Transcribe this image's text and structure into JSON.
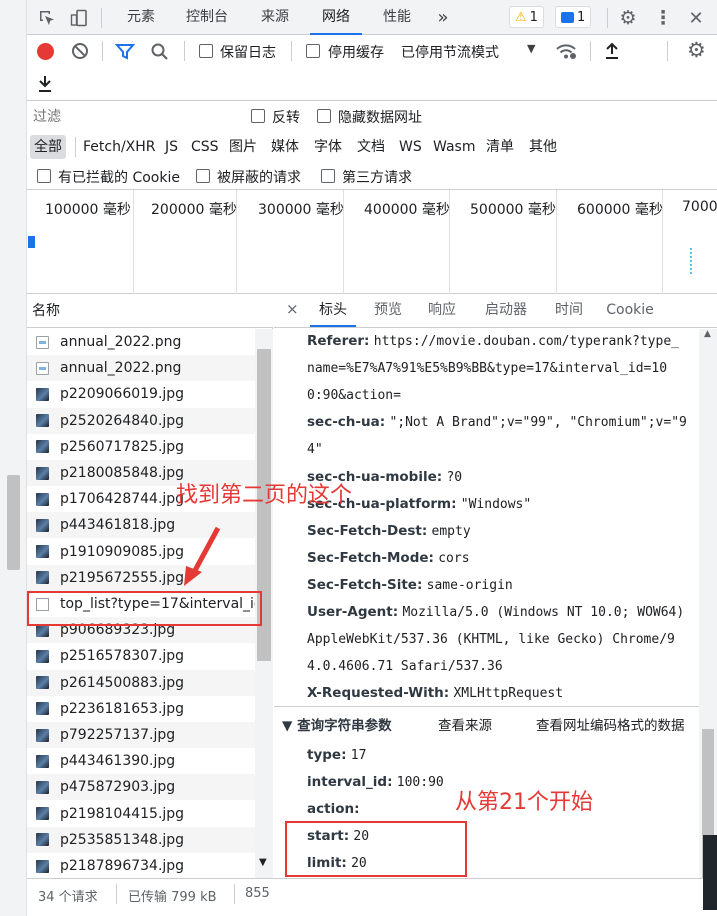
{
  "tabs": [
    "元素",
    "控制台",
    "来源",
    "网络",
    "性能"
  ],
  "more_tabs": "»",
  "warnings": {
    "icon": "warning-icon",
    "count": "1"
  },
  "messages": {
    "icon": "message-icon",
    "count": "1"
  },
  "toolbar": {
    "preserve_log": "保留日志",
    "disable_cache": "停用缓存",
    "throttle": "已停用节流模式"
  },
  "filter": {
    "placeholder": "过滤",
    "invert": "反转",
    "hide_data_urls": "隐藏数据网址"
  },
  "types": [
    "全部",
    "Fetch/XHR",
    "JS",
    "CSS",
    "图片",
    "媒体",
    "字体",
    "文档",
    "WS",
    "Wasm",
    "清单",
    "其他"
  ],
  "cookie_row": {
    "blocked_cookies": "有已拦截的 Cookie",
    "blocked_requests": "被屏蔽的请求",
    "third_party": "第三方请求"
  },
  "overview_ticks": [
    "100000 毫秒",
    "200000 毫秒",
    "300000 毫秒",
    "400000 毫秒",
    "500000 毫秒",
    "600000 毫秒",
    "7000"
  ],
  "list": {
    "header": "名称",
    "rows": [
      {
        "name": "annual_2022.png",
        "type": "png"
      },
      {
        "name": "annual_2022.png",
        "type": "png"
      },
      {
        "name": "p2209066019.jpg",
        "type": "jpg"
      },
      {
        "name": "p2520264840.jpg",
        "type": "jpg"
      },
      {
        "name": "p2560717825.jpg",
        "type": "jpg"
      },
      {
        "name": "p2180085848.jpg",
        "type": "jpg"
      },
      {
        "name": "p1706428744.jpg",
        "type": "jpg"
      },
      {
        "name": "p443461818.jpg",
        "type": "jpg"
      },
      {
        "name": "p1910909085.jpg",
        "type": "jpg"
      },
      {
        "name": "p2195672555.jpg",
        "type": "jpg"
      },
      {
        "name": "top_list?type=17&interval_id...",
        "type": "doc"
      },
      {
        "name": "p906689323.jpg",
        "type": "jpg"
      },
      {
        "name": "p2516578307.jpg",
        "type": "jpg"
      },
      {
        "name": "p2614500883.jpg",
        "type": "jpg"
      },
      {
        "name": "p2236181653.jpg",
        "type": "jpg"
      },
      {
        "name": "p792257137.jpg",
        "type": "jpg"
      },
      {
        "name": "p443461390.jpg",
        "type": "jpg"
      },
      {
        "name": "p475872903.jpg",
        "type": "jpg"
      },
      {
        "name": "p2198104415.jpg",
        "type": "jpg"
      },
      {
        "name": "p2535851348.jpg",
        "type": "jpg"
      },
      {
        "name": "p2187896734.jpg",
        "type": "jpg"
      }
    ]
  },
  "status": {
    "requests": "34 个请求",
    "transferred": "已传输 799 kB",
    "more": "855"
  },
  "details": {
    "close": "×",
    "tabs": [
      "标头",
      "预览",
      "响应",
      "启动器",
      "时间",
      "Cookie"
    ],
    "headers": [
      {
        "key": "Referer:",
        "value": "https://movie.douban.com/typerank?type_"
      },
      {
        "key": "",
        "value": "name=%E7%A7%91%E5%B9%BB&type=17&interval_id=10"
      },
      {
        "key": "",
        "value": "0:90&action="
      },
      {
        "key": "sec-ch-ua:",
        "value": "\";Not A Brand\";v=\"99\", \"Chromium\";v=\"9"
      },
      {
        "key": "",
        "value": "4\""
      },
      {
        "key": "sec-ch-ua-mobile:",
        "value": "?0"
      },
      {
        "key": "sec-ch-ua-platform:",
        "value": "\"Windows\""
      },
      {
        "key": "Sec-Fetch-Dest:",
        "value": "empty"
      },
      {
        "key": "Sec-Fetch-Mode:",
        "value": "cors"
      },
      {
        "key": "Sec-Fetch-Site:",
        "value": "same-origin"
      },
      {
        "key": "User-Agent:",
        "value": "Mozilla/5.0 (Windows NT 10.0; WOW64)"
      },
      {
        "key": "",
        "value": "AppleWebKit/537.36 (KHTML, like Gecko) Chrome/9"
      },
      {
        "key": "",
        "value": "4.0.4606.71 Safari/537.36"
      },
      {
        "key": "X-Requested-With:",
        "value": "XMLHttpRequest"
      }
    ],
    "query_section": {
      "title": "▼ 查询字符串参数",
      "view_source": "查看来源",
      "view_url_encoded": "查看网址编码格式的数据"
    },
    "params": [
      {
        "key": "type:",
        "value": "17"
      },
      {
        "key": "interval_id:",
        "value": "100:90"
      },
      {
        "key": "action:",
        "value": ""
      },
      {
        "key": "start:",
        "value": "20"
      },
      {
        "key": "limit:",
        "value": "20"
      }
    ]
  },
  "annotations": {
    "find_second_page": "找到第二页的这个",
    "start_from_21": "从第21个开始"
  },
  "colors": {
    "accent": "#1a73e8",
    "record": "#e53935",
    "annotation": "#e53935"
  }
}
